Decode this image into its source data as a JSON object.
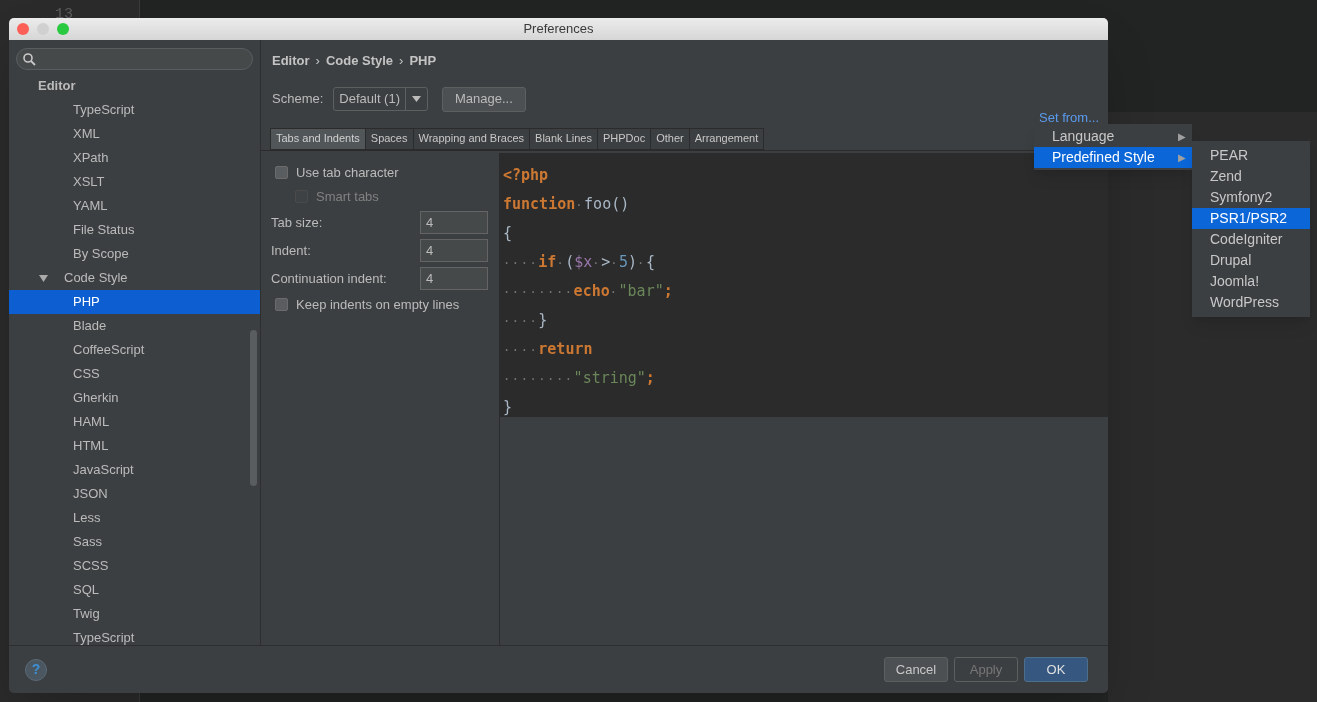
{
  "background_editor": {
    "line_number": "13"
  },
  "window": {
    "title": "Preferences"
  },
  "sidebar": {
    "items": [
      {
        "label": "Editor",
        "selected": false,
        "children": [
          {
            "label": "TypeScript",
            "selected": false
          },
          {
            "label": "XML",
            "selected": false
          },
          {
            "label": "XPath",
            "selected": false
          },
          {
            "label": "XSLT",
            "selected": false
          },
          {
            "label": "YAML",
            "selected": false
          },
          {
            "label": "File Status",
            "selected": false
          },
          {
            "label": "By Scope",
            "selected": false
          },
          {
            "label": "Code Style",
            "expanded": true,
            "selected": false,
            "children": [
              {
                "label": "PHP",
                "selected": true
              },
              {
                "label": "Blade",
                "selected": false
              },
              {
                "label": "CoffeeScript",
                "selected": false
              },
              {
                "label": "CSS",
                "selected": false
              },
              {
                "label": "Gherkin",
                "selected": false
              },
              {
                "label": "HAML",
                "selected": false
              },
              {
                "label": "HTML",
                "selected": false
              },
              {
                "label": "JavaScript",
                "selected": false
              },
              {
                "label": "JSON",
                "selected": false
              },
              {
                "label": "Less",
                "selected": false
              },
              {
                "label": "Sass",
                "selected": false
              },
              {
                "label": "SCSS",
                "selected": false
              },
              {
                "label": "SQL",
                "selected": false
              },
              {
                "label": "Twig",
                "selected": false
              },
              {
                "label": "TypeScript",
                "selected": false
              }
            ]
          }
        ]
      }
    ]
  },
  "breadcrumb": [
    "Editor",
    "Code Style",
    "PHP"
  ],
  "breadcrumb_separator": "›",
  "scheme": {
    "label": "Scheme:",
    "value": "Default (1)",
    "manage_button": "Manage..."
  },
  "set_from_link": "Set from...",
  "tabs": [
    {
      "label": "Tabs and Indents",
      "selected": true
    },
    {
      "label": "Spaces",
      "selected": false
    },
    {
      "label": "Wrapping and Braces",
      "selected": false
    },
    {
      "label": "Blank Lines",
      "selected": false
    },
    {
      "label": "PHPDoc",
      "selected": false
    },
    {
      "label": "Other",
      "selected": false
    },
    {
      "label": "Arrangement",
      "selected": false
    }
  ],
  "options": [
    {
      "kind": "checkbox",
      "label": "Use tab character",
      "checked": false,
      "disabled": false,
      "nested": false
    },
    {
      "kind": "checkbox",
      "label": "Smart tabs",
      "checked": false,
      "disabled": true,
      "nested": true
    },
    {
      "kind": "field",
      "label": "Tab size:",
      "value": "4"
    },
    {
      "kind": "field",
      "label": "Indent:",
      "value": "4"
    },
    {
      "kind": "field",
      "label": "Continuation indent:",
      "value": "4"
    },
    {
      "kind": "checkbox",
      "label": "Keep indents on empty lines",
      "checked": false,
      "disabled": false,
      "nested": false
    }
  ],
  "code_preview": [
    [
      {
        "kind": "keyword",
        "text": "<?php"
      }
    ],
    [
      {
        "kind": "keyword",
        "text": "function"
      },
      {
        "kind": "ws",
        "text": "·"
      },
      {
        "kind": "plain",
        "text": "foo()"
      }
    ],
    [
      {
        "kind": "plain",
        "text": "{"
      }
    ],
    [
      {
        "kind": "ws",
        "text": "····"
      },
      {
        "kind": "keyword",
        "text": "if"
      },
      {
        "kind": "ws",
        "text": "·"
      },
      {
        "kind": "plain",
        "text": "("
      },
      {
        "kind": "variable",
        "text": "$x"
      },
      {
        "kind": "ws",
        "text": "·"
      },
      {
        "kind": "plain",
        "text": ">"
      },
      {
        "kind": "ws",
        "text": "·"
      },
      {
        "kind": "number",
        "text": "5"
      },
      {
        "kind": "plain",
        "text": ")"
      },
      {
        "kind": "ws",
        "text": "·"
      },
      {
        "kind": "plain",
        "text": "{"
      }
    ],
    [
      {
        "kind": "ws",
        "text": "········"
      },
      {
        "kind": "keyword",
        "text": "echo"
      },
      {
        "kind": "ws",
        "text": "·"
      },
      {
        "kind": "string",
        "text": "\"bar\""
      },
      {
        "kind": "keyword",
        "text": ";"
      }
    ],
    [
      {
        "kind": "ws",
        "text": "····"
      },
      {
        "kind": "plain",
        "text": "}"
      }
    ],
    [
      {
        "kind": "ws",
        "text": "····"
      },
      {
        "kind": "keyword",
        "text": "return"
      }
    ],
    [
      {
        "kind": "ws",
        "text": "········"
      },
      {
        "kind": "string",
        "text": "\"string\""
      },
      {
        "kind": "keyword",
        "text": ";"
      }
    ],
    [
      {
        "kind": "plain",
        "text": "}"
      }
    ]
  ],
  "set_from_menu": [
    {
      "label": "Language",
      "submenu_arrow": "▶",
      "selected": false
    },
    {
      "label": "Predefined Style",
      "submenu_arrow": "▶",
      "selected": true
    }
  ],
  "predefined_styles": [
    {
      "label": "PEAR",
      "selected": false
    },
    {
      "label": "Zend",
      "selected": false
    },
    {
      "label": "Symfony2",
      "selected": false
    },
    {
      "label": "PSR1/PSR2",
      "selected": true
    },
    {
      "label": "CodeIgniter",
      "selected": false
    },
    {
      "label": "Drupal",
      "selected": false
    },
    {
      "label": "Joomla!",
      "selected": false
    },
    {
      "label": "WordPress",
      "selected": false
    }
  ],
  "footer": {
    "help": "?",
    "buttons": [
      {
        "label": "Cancel",
        "kind": "normal",
        "disabled": false
      },
      {
        "label": "Apply",
        "kind": "normal",
        "disabled": true
      },
      {
        "label": "OK",
        "kind": "default",
        "disabled": false
      }
    ]
  }
}
